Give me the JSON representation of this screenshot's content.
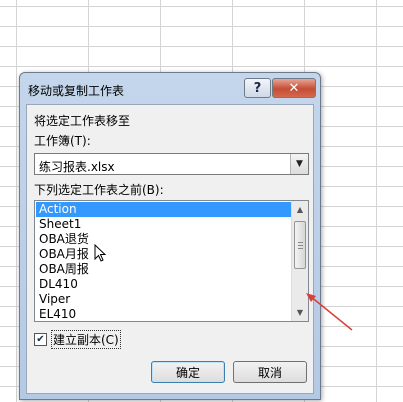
{
  "dialog": {
    "title": "移动或复制工作表",
    "help_glyph": "?",
    "close_glyph": "✕",
    "intro_label": "将选定工作表移至",
    "book_label": "工作簿(T):",
    "book_value": "练习报表.xlsx",
    "before_label": "下列选定工作表之前(B):",
    "sheets": [
      "Action",
      "Sheet1",
      "OBA退货",
      "OBA月报",
      "OBA周报",
      "DL410",
      "Viper",
      "EL410"
    ],
    "selected_index": 0,
    "create_copy_label": "建立副本(C)",
    "create_copy_checked": true,
    "ok_label": "确定",
    "cancel_label": "取消",
    "check_glyph": "✔"
  },
  "colors": {
    "selection": "#3399ff",
    "annotation_arrow": "#d9403a"
  }
}
